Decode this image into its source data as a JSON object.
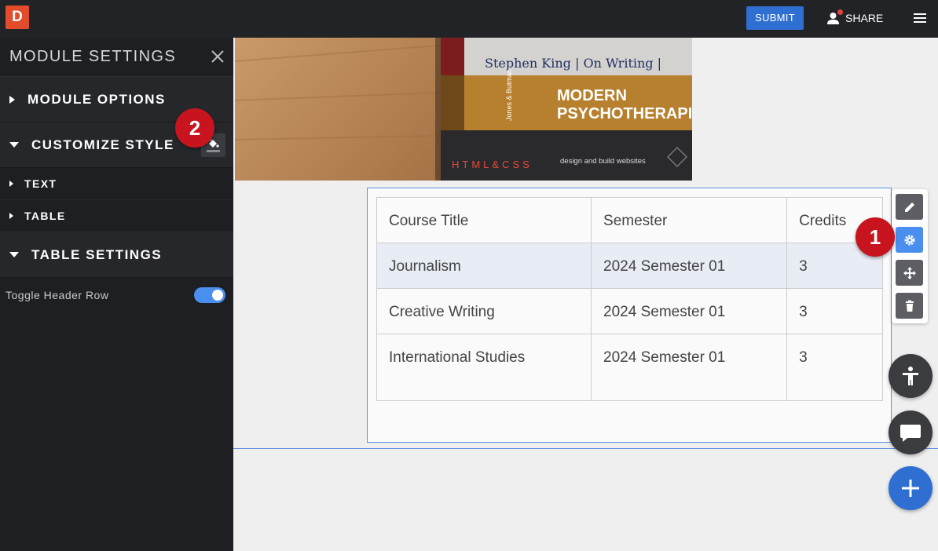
{
  "topbar": {
    "logo_letter": "D",
    "submit_label": "SUBMIT",
    "share_label": "SHARE"
  },
  "sidebar": {
    "title": "MODULE SETTINGS",
    "sections": {
      "module_options": "MODULE OPTIONS",
      "customize_style": "CUSTOMIZE STYLE",
      "text": "TEXT",
      "table": "TABLE",
      "table_settings": "TABLE SETTINGS"
    },
    "toggle_header_row": {
      "label": "Toggle Header Row",
      "on": true
    }
  },
  "badges": {
    "one": "1",
    "two": "2"
  },
  "photo": {
    "book1": "Stephen King | On Writing |",
    "book2_line1": "MODERN",
    "book2_line2": "PSYCHOTHERAPI",
    "book2_spine": "Jones & Butman",
    "book3_letters": "HTML&CSS",
    "book3_subtitle": "design and build websites"
  },
  "table": {
    "headers": [
      "Course Title",
      "Semester",
      "Credits"
    ],
    "rows": [
      [
        "Journalism",
        "2024 Semester 01",
        "3"
      ],
      [
        "Creative Writing",
        "2024 Semester 01",
        "3"
      ],
      [
        "International Studies",
        "2024 Semester 01",
        "3"
      ]
    ]
  },
  "colors": {
    "accent_blue": "#2f6fd1",
    "badge_red": "#c8141f",
    "logo_orange": "#e24b2b",
    "sidebar_bg": "#1e1f22"
  },
  "icons": {
    "tools": [
      "pencil-icon",
      "gear-icon",
      "move-icon",
      "trash-icon"
    ],
    "fabs": [
      "accessibility-icon",
      "chat-icon",
      "plus-icon"
    ]
  }
}
